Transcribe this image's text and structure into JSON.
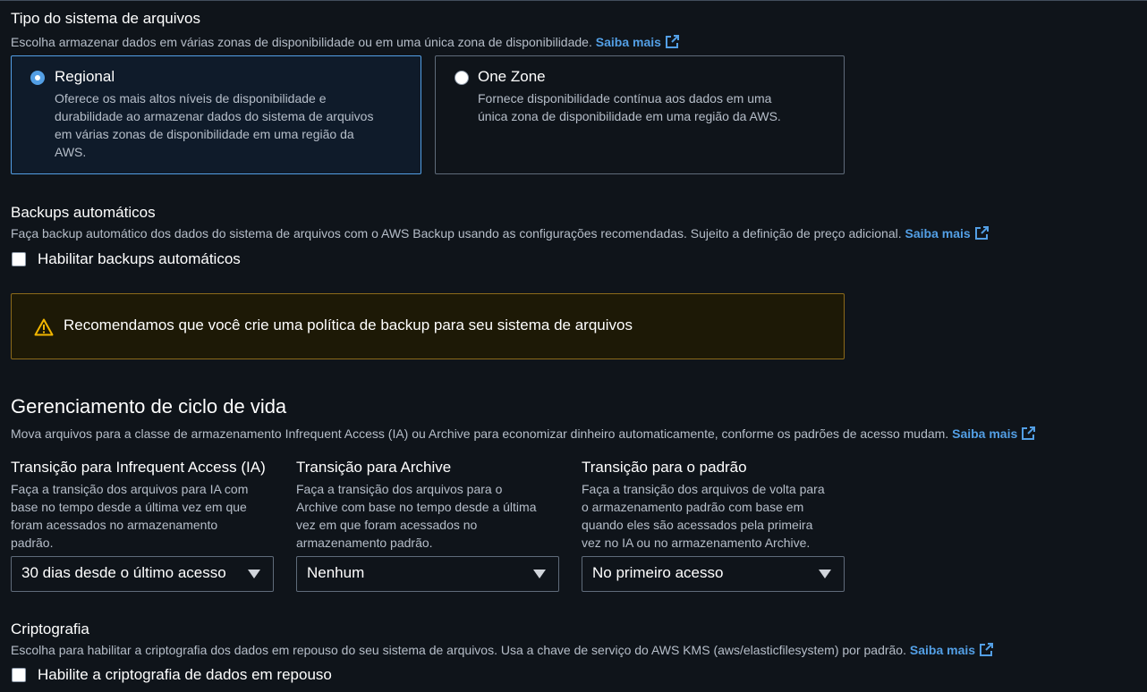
{
  "filesystem_type": {
    "title": "Tipo do sistema de arquivos",
    "description": "Escolha armazenar dados em várias zonas de disponibilidade ou em uma única zona de disponibilidade.",
    "learn_more": "Saiba mais",
    "options": [
      {
        "title": "Regional",
        "description_lines": [
          "Oferece os mais altos níveis de disponibilidade e",
          "durabilidade ao armazenar dados do sistema de arquivos",
          "em várias zonas de disponibilidade em uma região da",
          "AWS."
        ],
        "selected": true
      },
      {
        "title": "One Zone",
        "description_lines": [
          "Fornece disponibilidade contínua aos dados em uma",
          "única zona de disponibilidade em uma região da AWS."
        ],
        "selected": false
      }
    ]
  },
  "backups": {
    "title": "Backups automáticos",
    "description": "Faça backup automático dos dados do sistema de arquivos com o AWS Backup usando as configurações recomendadas. Sujeito a definição de preço adicional.",
    "learn_more": "Saiba mais",
    "checkbox_label": "Habilitar backups automáticos",
    "checked": false,
    "warning": "Recomendamos que você crie uma política de backup para seu sistema de arquivos"
  },
  "lifecycle": {
    "title": "Gerenciamento de ciclo de vida",
    "description": "Mova arquivos para a classe de armazenamento Infrequent Access (IA) ou Archive para economizar dinheiro automaticamente, conforme os padrões de acesso mudam.",
    "learn_more": "Saiba mais",
    "columns": [
      {
        "title": "Transição para Infrequent Access (IA)",
        "description_lines": [
          "Faça a transição dos arquivos para IA com",
          "base no tempo desde a última vez em que",
          "foram acessados no armazenamento",
          "padrão."
        ],
        "value": "30 dias desde o último acesso"
      },
      {
        "title": "Transição para Archive",
        "description_lines": [
          "Faça a transição dos arquivos para o",
          "Archive com base no tempo desde a última",
          "vez em que foram acessados no",
          "armazenamento padrão."
        ],
        "value": "Nenhum"
      },
      {
        "title": "Transição para o padrão",
        "description_lines": [
          "Faça a transição dos arquivos de volta para",
          "o armazenamento padrão com base em",
          "quando eles são acessados pela primeira",
          "vez no IA ou no armazenamento Archive."
        ],
        "value": "No primeiro acesso"
      }
    ]
  },
  "encryption": {
    "title": "Criptografia",
    "description": "Escolha para habilitar a criptografia dos dados em repouso do seu sistema de arquivos. Usa a chave de serviço do AWS KMS (aws/elasticfilesystem) por padrão.",
    "learn_more": "Saiba mais",
    "checkbox_label": "Habilite a criptografia de dados em repouso",
    "checked": false
  },
  "colors": {
    "accent": "#539fe5",
    "warning_border": "#8c6a1a",
    "warning_icon": "#f2b600"
  }
}
